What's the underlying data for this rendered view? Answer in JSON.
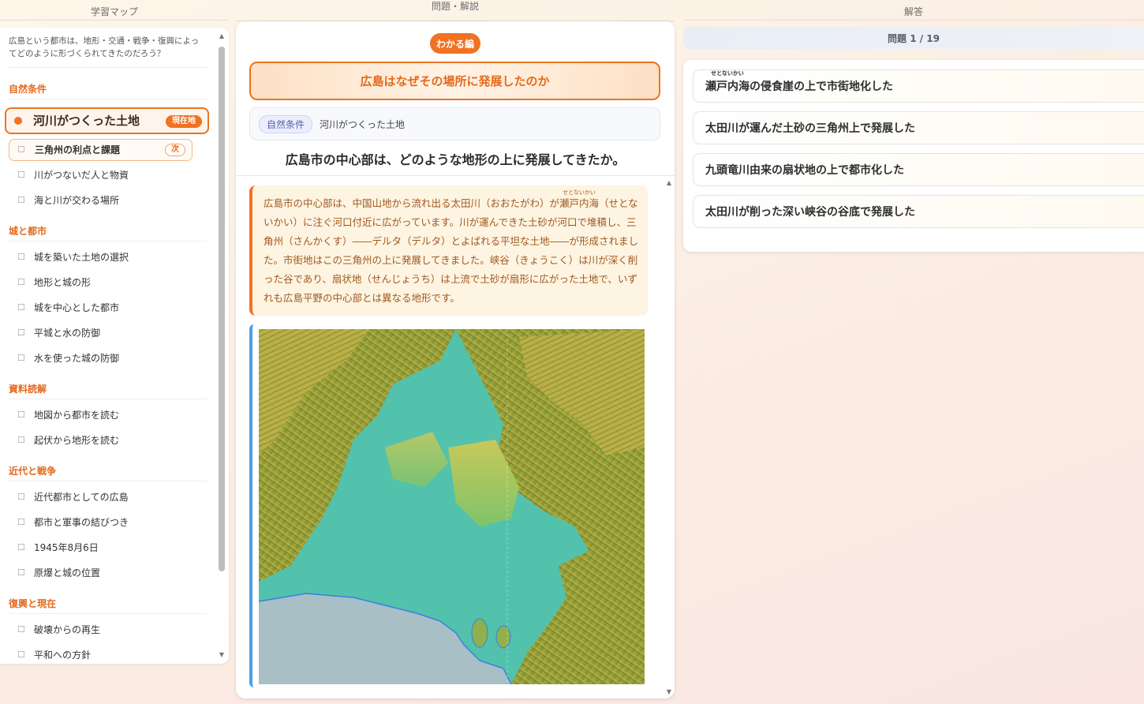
{
  "headers": {
    "left": "学習マップ",
    "middle": "問題・解説",
    "right": "解答"
  },
  "left": {
    "question": "広島という都市は、地形・交通・戦争・復興によってどのように形づくられてきたのだろう？",
    "sections": [
      {
        "title": "自然条件"
      },
      {
        "title": "城と都市"
      },
      {
        "title": "資料読解"
      },
      {
        "title": "近代と戦争"
      },
      {
        "title": "復興と現在"
      }
    ],
    "current_item": {
      "label": "河川がつくった土地",
      "badge": "現在地"
    },
    "next_item": {
      "label": "三角州の利点と課題",
      "badge": "次"
    },
    "checkbox_glyph": "☐",
    "items": {
      "nature_1": "川がつないだ人と物資",
      "nature_2": "海と川が交わる場所",
      "castle_0": "城を築いた土地の選択",
      "castle_1": "地形と城の形",
      "castle_2": "城を中心とした都市",
      "castle_3": "平城と水の防御",
      "castle_4": "水を使った城の防御",
      "reading_0": "地図から都市を読む",
      "reading_1": "起伏から地形を読む",
      "modern_0": "近代都市としての広島",
      "modern_1": "都市と軍事の結びつき",
      "modern_2": "1945年8月6日",
      "modern_3": "原爆と城の位置",
      "recovery_0": "破壊からの再生",
      "recovery_1": "平和への方針"
    }
  },
  "middle": {
    "level_badge": "わかる編",
    "title": "広島はなぜその場所に発展したのか",
    "tag": "自然条件",
    "tag_text": "河川がつくった土地",
    "question": "広島市の中心部は、どのような地形の上に発展してきたか。",
    "explanation": {
      "part1": "広島市の中心部は、中国山地から流れ出る太田川（おおたがわ）が",
      "ruby_base": "瀬戸内海",
      "ruby_text": "せとないかい",
      "part2": "（せとないかい）に注ぐ河口付近に広がっています。川が運んできた土砂が河口で堆積し、三角州（さんかくす）――デルタ（デルタ）とよばれる平坦な土地――が形成されました。市街地はこの三角州の上に発展してきました。峡谷（きょうこく）は川が深く削った谷であり、扇状地（せんじょうち）は上流で土砂が扇形に広がった土地で、いずれも広島平野の中心部とは異なる地形です。"
    },
    "map_colors": {
      "sea": "#a9bfc6",
      "lowland": "#4fc3b0",
      "hills": "#c9c85a",
      "mountains": "#8a6a28",
      "coast": "#3b7fe0"
    }
  },
  "right": {
    "counter": "問題 1 / 19",
    "options": [
      {
        "ruby_base": "瀬戸内海",
        "ruby_text": "せとないかい",
        "rest": "の侵食崖の上で市街地化した"
      },
      {
        "label": "太田川が運んだ土砂の三角州上で発展した"
      },
      {
        "label": "九頭竜川由来の扇状地の上で都市化した"
      },
      {
        "label": "太田川が削った深い峡谷の谷底で発展した"
      }
    ]
  }
}
